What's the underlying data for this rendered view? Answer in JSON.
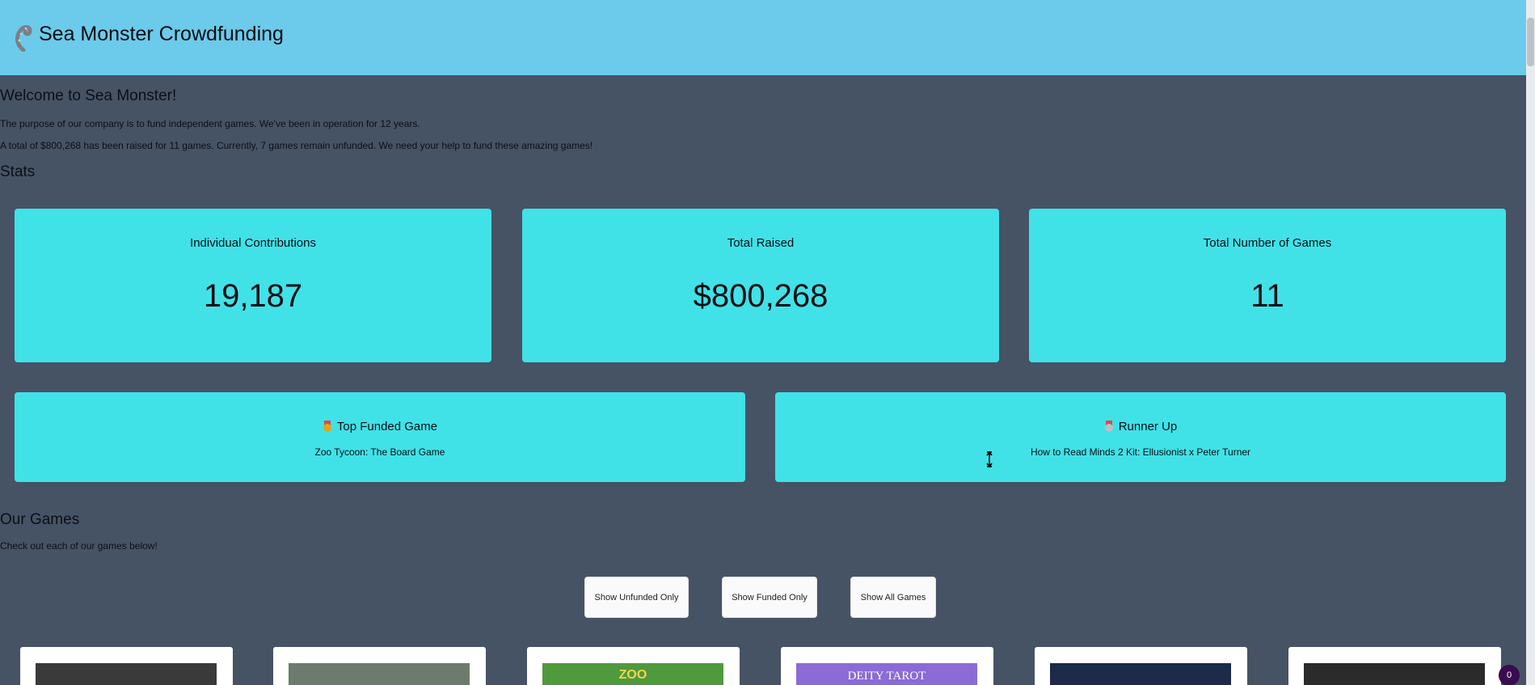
{
  "header": {
    "title": "Sea Monster Crowdfunding",
    "logo_icon": "tentacle-icon",
    "background": "#6ccaea"
  },
  "welcome": {
    "heading": "Welcome to Sea Monster!",
    "purpose": "The purpose of our company is to fund independent games. We've been in operation for 12 years.",
    "summary": "A total of $800,268 has been raised for 11 games. Currently, 7 games remain unfunded. We need your help to fund these amazing games!"
  },
  "stats": {
    "heading": "Stats",
    "cards": [
      {
        "label": "Individual Contributions",
        "value": "19,187"
      },
      {
        "label": "Total Raised",
        "value": "$800,268"
      },
      {
        "label": "Total Number of Games",
        "value": "11"
      }
    ]
  },
  "featured": {
    "top": {
      "title": "Top Funded Game",
      "name": "Zoo Tycoon: The Board Game",
      "icon": "gold-medal-icon"
    },
    "runner_up": {
      "title": "Runner Up",
      "name": "How to Read Minds 2 Kit: Ellusionist x Peter Turner",
      "icon": "silver-medal-icon"
    }
  },
  "games": {
    "heading": "Our Games",
    "subheading": "Check out each of our games below!",
    "buttons": {
      "unfunded": "Show Unfunded Only",
      "funded": "Show Funded Only",
      "all": "Show All Games"
    },
    "thumbs": [
      {
        "caption": "",
        "color": "#3a3a3a"
      },
      {
        "caption": "",
        "color": "#6c7b6e"
      },
      {
        "caption": "ZOO",
        "color": "#4f9a3c"
      },
      {
        "caption": "DEITY TAROT",
        "color": "#8b6bd6"
      },
      {
        "caption": "",
        "color": "#1e2a4a"
      },
      {
        "caption": "",
        "color": "#2b2b2b"
      }
    ]
  },
  "badge": {
    "count": "0"
  },
  "colors": {
    "accent": "#40e2e8",
    "page": "#465365"
  }
}
